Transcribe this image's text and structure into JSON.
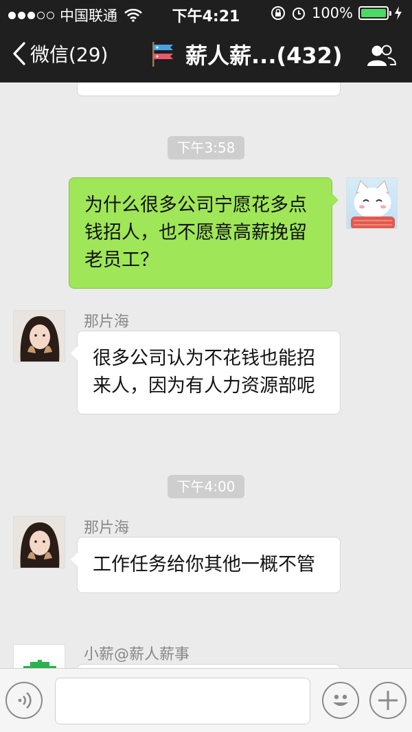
{
  "status_bar": {
    "carrier": "中国联通",
    "time": "下午4:21",
    "battery": "100%"
  },
  "nav": {
    "back_label": "微信(29)",
    "title": "薪人薪...(432)"
  },
  "messages": {
    "m0_time": "下午3:58",
    "m1_text": "为什么很多公司宁愿花多点钱招人，也不愿意高薪挽留老员工？",
    "m2_sender": "那片海",
    "m2_text": "很多公司认为不花钱也能招来人，因为有人力资源部呢",
    "m3_time": "下午4:00",
    "m4_sender": "那片海",
    "m4_text": "工作任务给你其他一概不管",
    "m5_sender": "小薪@薪人薪事"
  },
  "colors": {
    "header_bg": "#1f1f1f",
    "chat_bg": "#ebebeb",
    "my_bubble": "#9fe658",
    "battery_green": "#4cd964"
  },
  "icons": {
    "back": "chevron-left-icon",
    "group_members": "people-icon",
    "voice": "voice-icon",
    "emoji": "emoji-icon",
    "add": "plus-icon"
  }
}
